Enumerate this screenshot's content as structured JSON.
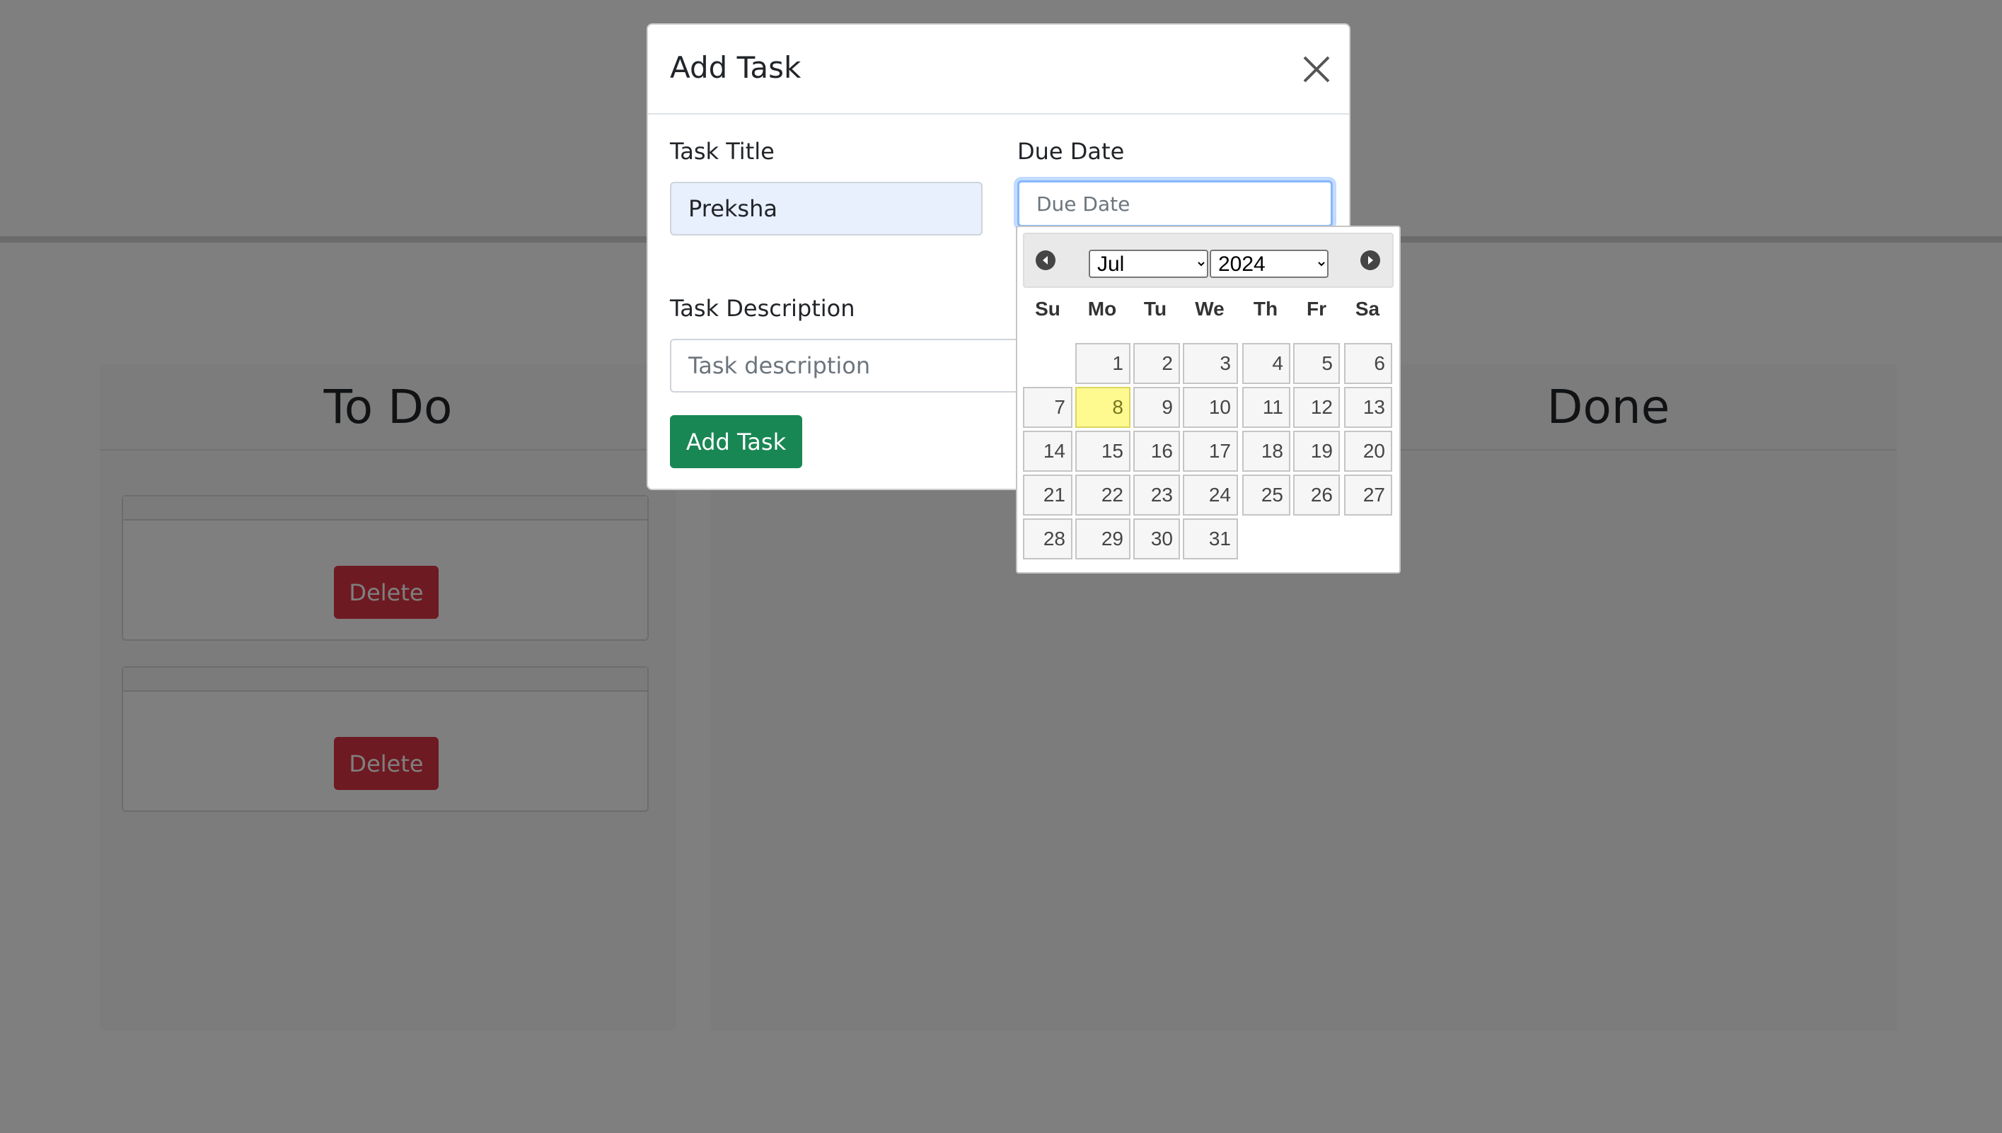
{
  "columns": [
    {
      "title": "To Do"
    },
    {
      "title": ""
    },
    {
      "title": "Done"
    }
  ],
  "todo_cards": [
    {
      "delete_label": "Delete"
    },
    {
      "delete_label": "Delete"
    }
  ],
  "modal": {
    "title": "Add Task",
    "close_icon": "close-icon",
    "task_title_label": "Task Title",
    "task_title_value": "Preksha",
    "due_date_label": "Due Date",
    "due_date_placeholder": "Due Date",
    "task_description_label": "Task Description",
    "task_description_placeholder": "Task description",
    "add_button": "Add Task"
  },
  "datepicker": {
    "month": "Jul",
    "year": "2024",
    "prev_icon": "chevron-left-icon",
    "next_icon": "chevron-right-icon",
    "weekdays": [
      "Su",
      "Mo",
      "Tu",
      "We",
      "Th",
      "Fr",
      "Sa"
    ],
    "today": 8,
    "days": [
      "1",
      "2",
      "3",
      "4",
      "5",
      "6",
      "7",
      "8",
      "9",
      "10",
      "11",
      "12",
      "13",
      "14",
      "15",
      "16",
      "17",
      "18",
      "19",
      "20",
      "21",
      "22",
      "23",
      "24",
      "25",
      "26",
      "27",
      "28",
      "29",
      "30",
      "31"
    ]
  },
  "colors": {
    "success": "#198754",
    "danger": "#dc3545",
    "highlight": "#fffa90"
  }
}
